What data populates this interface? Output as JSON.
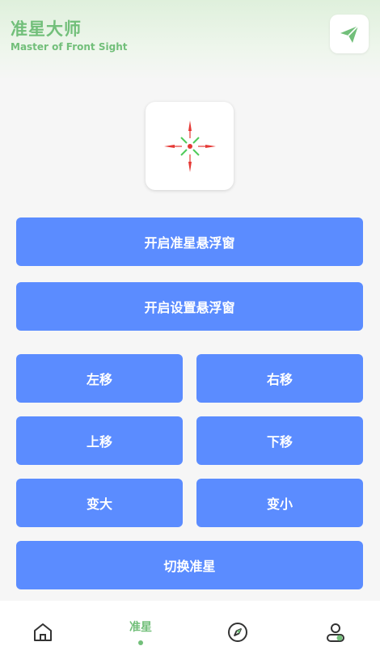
{
  "header": {
    "title": "准星大师",
    "subtitle": "Master of Front Sight",
    "action_icon": "paper-plane-icon"
  },
  "preview": {
    "icon": "crosshair-icon"
  },
  "buttons": {
    "open_crosshair_overlay": "开启准星悬浮窗",
    "open_settings_overlay": "开启设置悬浮窗",
    "move_left": "左移",
    "move_right": "右移",
    "move_up": "上移",
    "move_down": "下移",
    "bigger": "变大",
    "smaller": "变小",
    "switch_crosshair": "切换准星"
  },
  "tabbar": {
    "tabs": [
      {
        "icon": "home-icon",
        "label": ""
      },
      {
        "icon": "crosshair-tab",
        "label": "准星",
        "active": true
      },
      {
        "icon": "compass-icon",
        "label": ""
      },
      {
        "icon": "profile-icon",
        "label": ""
      }
    ]
  },
  "colors": {
    "accent_green": "#72bf7a",
    "button_blue": "#5b8cff",
    "background": "#f6f6f6"
  }
}
